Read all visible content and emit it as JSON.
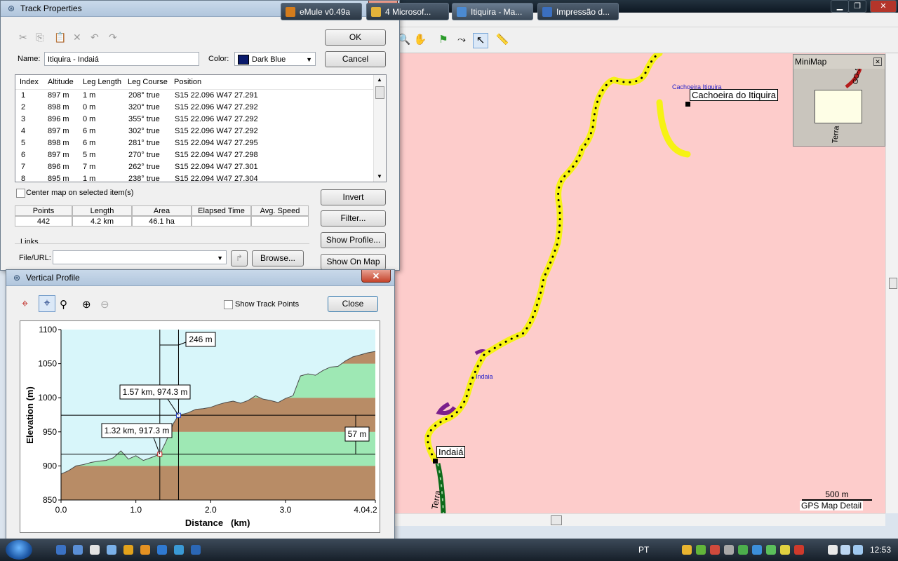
{
  "track_properties": {
    "title": "Track Properties",
    "ok": "OK",
    "cancel": "Cancel",
    "name_label": "Name:",
    "name_value": "Itiquira - Indaiá",
    "color_label": "Color:",
    "color_value": "Dark Blue",
    "color_swatch": "#0a1a6c",
    "columns": [
      "Index",
      "Altitude",
      "Leg Length",
      "Leg Course",
      "Position"
    ],
    "rows": [
      [
        "1",
        "897 m",
        "1 m",
        "208° true",
        "S15 22.096 W47 27.291"
      ],
      [
        "2",
        "898 m",
        "0 m",
        "320° true",
        "S15 22.096 W47 27.292"
      ],
      [
        "3",
        "896 m",
        "0 m",
        "355° true",
        "S15 22.096 W47 27.292"
      ],
      [
        "4",
        "897 m",
        "6 m",
        "302° true",
        "S15 22.096 W47 27.292"
      ],
      [
        "5",
        "898 m",
        "6 m",
        "281° true",
        "S15 22.094 W47 27.295"
      ],
      [
        "6",
        "897 m",
        "5 m",
        "270° true",
        "S15 22.094 W47 27.298"
      ],
      [
        "7",
        "896 m",
        "7 m",
        "262° true",
        "S15 22.094 W47 27.301"
      ],
      [
        "8",
        "895 m",
        "1 m",
        "238° true",
        "S15 22.094 W47 27.304"
      ]
    ],
    "center_map_label": "Center map on selected item(s)",
    "invert": "Invert",
    "filter": "Filter...",
    "show_profile": "Show Profile...",
    "show_on_map": "Show On Map",
    "stats_headers": [
      "Points",
      "Length",
      "Area",
      "Elapsed Time",
      "Avg. Speed"
    ],
    "stats_values": [
      "442",
      "4.2 km",
      "46.1 ha",
      "",
      ""
    ],
    "links_label": "Links",
    "file_url_label": "File/URL:",
    "browse": "Browse..."
  },
  "vertical_profile": {
    "title": "Vertical Profile",
    "show_track_points": "Show Track Points",
    "close": "Close",
    "x_label": "Distance",
    "x_unit": "(km)",
    "y_label": "Elevation (m)",
    "x_ticks": [
      "0.0",
      "1.0",
      "2.0",
      "3.0",
      "4.04.2"
    ],
    "y_ticks": [
      "850",
      "900",
      "950",
      "1000",
      "1050",
      "1100"
    ],
    "callout_dx": "246 m",
    "callout_p2": "1.57 km, 974.3 m",
    "callout_p1": "1.32 km, 917.3 m",
    "callout_dy": "57 m"
  },
  "chart_data": {
    "type": "area",
    "x_label": "Distance (km)",
    "y_label": "Elevation (m)",
    "xlim": [
      0,
      4.2
    ],
    "ylim": [
      850,
      1100
    ],
    "x": [
      0.0,
      0.1,
      0.2,
      0.3,
      0.4,
      0.5,
      0.6,
      0.7,
      0.8,
      0.9,
      1.0,
      1.1,
      1.2,
      1.32,
      1.4,
      1.5,
      1.57,
      1.7,
      1.8,
      1.9,
      2.0,
      2.1,
      2.2,
      2.3,
      2.4,
      2.5,
      2.6,
      2.7,
      2.8,
      2.9,
      3.0,
      3.1,
      3.2,
      3.3,
      3.4,
      3.5,
      3.6,
      3.7,
      3.8,
      3.9,
      4.0,
      4.1,
      4.2
    ],
    "y": [
      888,
      893,
      900,
      902,
      905,
      907,
      908,
      912,
      922,
      910,
      915,
      908,
      912,
      917.3,
      935,
      962,
      974.3,
      978,
      983,
      984,
      986,
      990,
      993,
      995,
      992,
      996,
      1003,
      998,
      996,
      993,
      999,
      1003,
      1032,
      1035,
      1033,
      1040,
      1045,
      1046,
      1054,
      1060,
      1063,
      1066,
      1068
    ],
    "markers": [
      {
        "x": 1.32,
        "y": 917.3
      },
      {
        "x": 1.57,
        "y": 974.3
      }
    ]
  },
  "map": {
    "label_cachoeira_small": "Cachoeira Itiquira",
    "label_cachoeira": "Cachoeira do Itiquira",
    "label_indaia_small": "Indaia",
    "label_indaia": "Indaiá",
    "label_terra": "Terra",
    "scale_text": "500 m",
    "scale_caption": "GPS Map Detail",
    "minimap_title": "MiniMap",
    "minimap_terra": "Terra",
    "minimap_road": "GO-S"
  },
  "taskbar": {
    "tasks": [
      "eMule v0.49a",
      "4 Microsof...",
      "Itiquira - Ma...",
      "Impressão d..."
    ],
    "lang": "PT",
    "clock": "12:53"
  },
  "colors": {
    "map_bg": "#fdcccb",
    "track": "#f6f214",
    "sky": "#d8f6fa",
    "terrain": "#b88c66",
    "band": "#9ee8b4"
  }
}
